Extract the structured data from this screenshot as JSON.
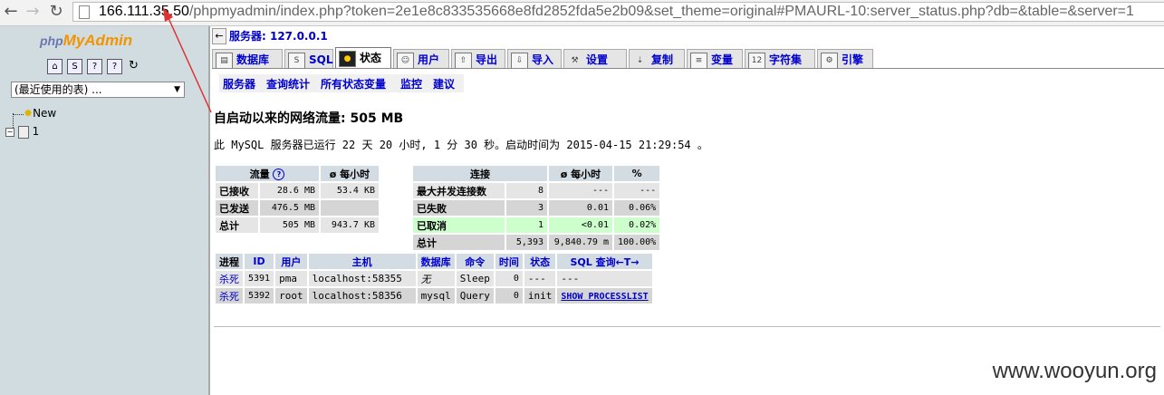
{
  "browser": {
    "url_host": "166.111.35.50",
    "url_rest": "/phpmyadmin/index.php?token=2e1e8c833535668e8fd2852fda5e2b09&set_theme=original#PMAURL-10:server_status.php?db=&table=&server=1"
  },
  "left": {
    "logo_php": "php",
    "logo_my": "My",
    "logo_admin": "Admin",
    "recent_select": "(最近使用的表) ...",
    "tree_new": "New",
    "tree_db": "1"
  },
  "header": {
    "server_label": "服务器: 127.0.0.1"
  },
  "tabs": [
    {
      "label": "数据库"
    },
    {
      "label": "SQL"
    },
    {
      "label": "状态"
    },
    {
      "label": "用户"
    },
    {
      "label": "导出"
    },
    {
      "label": "导入"
    },
    {
      "label": "设置"
    },
    {
      "label": "复制"
    },
    {
      "label": "变量"
    },
    {
      "label": "字符集"
    },
    {
      "label": "引擎"
    }
  ],
  "subnav": [
    "服务器",
    "查询统计",
    "所有状态变量",
    "监控",
    "建议"
  ],
  "heading": "自启动以来的网络流量: 505 MB",
  "uptime": "此 MySQL 服务器已运行 22 天 20 小时, 1 分 30 秒。启动时间为 2015-04-15 21:29:54 。",
  "traffic": {
    "headers": [
      "流量",
      "ø 每小时"
    ],
    "rows": [
      {
        "label": "已接收",
        "value": "28.6 MB",
        "per_hour": "53.4 KB"
      },
      {
        "label": "已发送",
        "value": "476.5 MB",
        "per_hour": ""
      },
      {
        "label": "总计",
        "value": "505 MB",
        "per_hour": "943.7 KB"
      }
    ]
  },
  "connections": {
    "headers": [
      "连接",
      "ø 每小时",
      "%"
    ],
    "rows": [
      {
        "label": "最大并发连接数",
        "value": "8",
        "per_hour": "---",
        "pct": "---"
      },
      {
        "label": "已失败",
        "value": "3",
        "per_hour": "0.01",
        "pct": "0.06%"
      },
      {
        "label": "已取消",
        "value": "1",
        "per_hour": "<0.01",
        "pct": "0.02%"
      },
      {
        "label": "总计",
        "value": "5,393",
        "per_hour": "9,840.79 m",
        "pct": "100.00%"
      }
    ]
  },
  "processes": {
    "headers": [
      "进程",
      "ID",
      "用户",
      "主机",
      "数据库",
      "命令",
      "时间",
      "状态",
      "SQL 查询"
    ],
    "trunc_icon": "←T→",
    "rows": [
      {
        "kill": "杀死",
        "id": "5391",
        "user": "pma",
        "host": "localhost:58355",
        "db": "无",
        "command": "Sleep",
        "time": "0",
        "state": "---",
        "query": "---"
      },
      {
        "kill": "杀死",
        "id": "5392",
        "user": "root",
        "host": "localhost:58356",
        "db": "mysql",
        "command": "Query",
        "time": "0",
        "state": "init",
        "query": "SHOW PROCESSLIST"
      }
    ]
  },
  "watermark": "www.wooyun.org",
  "colors": {
    "left_bg": "#d0dce0",
    "th_bg": "#d3dce3",
    "highlight_row": "#ccffcc",
    "link": "#0000cc",
    "annotation_arrow": "#e03030"
  }
}
